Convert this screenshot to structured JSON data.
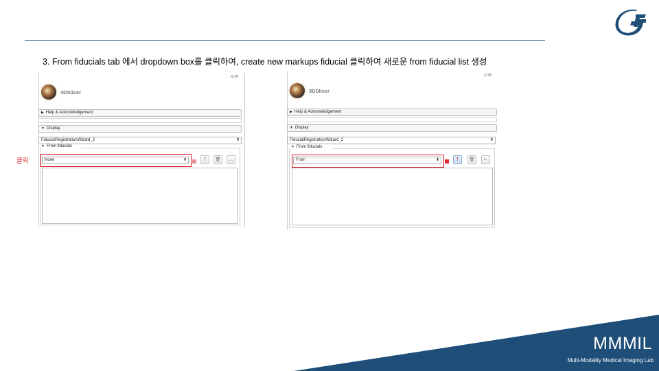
{
  "slide": {
    "instruction": "3. From fiducials tab 에서 dropdown box를 클릭하여, create new markups fiducial 클릭하여 새로운 from fiducial list 생성",
    "click_annotation": "클릭",
    "brand": "MMMIL",
    "brand_subtitle": "Multi-Modality Medical Imaging Lab",
    "accent_color": "#1f4e79",
    "annotation_color": "#d9191f"
  },
  "screens": [
    {
      "app_name": "3DSlicer",
      "help_section": "Help & Acknowledgement",
      "display_section": "Display",
      "module_select": "FiducialRegistrationWizard_2",
      "group_title": "From fiducials",
      "fiducial_dropdown_value": "None",
      "icons": [
        "color-square-icon",
        "place-fiducial-icon",
        "delete-icon",
        "more-icon"
      ]
    },
    {
      "app_name": "3DSlicer",
      "help_section": "Help & Acknowledgement",
      "display_section": "Display",
      "module_select": "FiducialRegistrationWizard_2",
      "group_title": "From fiducials",
      "fiducial_dropdown_value": "From",
      "icons": [
        "color-square-icon",
        "place-fiducial-icon",
        "delete-icon",
        "more-icon"
      ]
    }
  ]
}
